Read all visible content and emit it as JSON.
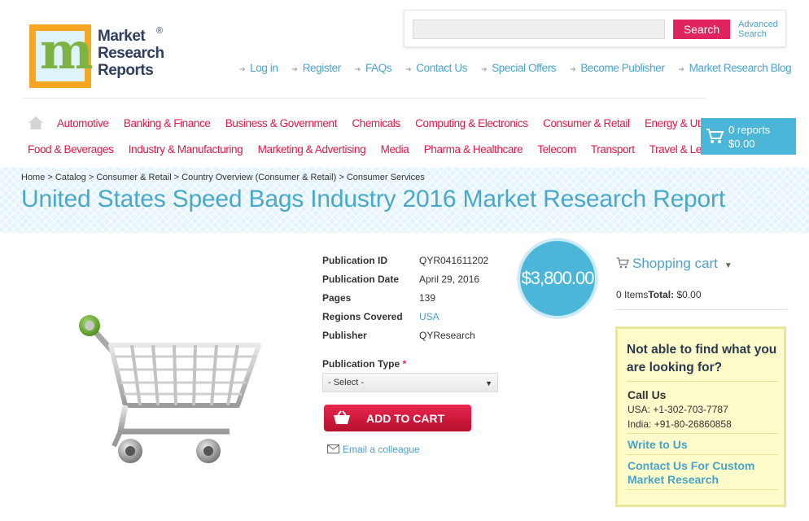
{
  "logo": {
    "line1": "Market",
    "line2": "Research",
    "line3": "Reports",
    "reg": "®",
    "mark": "m"
  },
  "search": {
    "placeholder": "",
    "button": "Search",
    "advanced_line1": "Advanced",
    "advanced_line2": "Search"
  },
  "toplinks": [
    "Log in",
    "Register",
    "FAQs",
    "Contact Us",
    "Special Offers",
    "Become Publisher",
    "Market Research Blog"
  ],
  "categories_row1": [
    "Automotive",
    "Banking & Finance",
    "Business & Government",
    "Chemicals",
    "Computing & Electronics",
    "Consumer & Retail",
    "Energy & Utilities"
  ],
  "categories_row2": [
    "Food & Beverages",
    "Industry & Manufacturing",
    "Marketing & Advertising",
    "Media",
    "Pharma & Healthcare",
    "Telecom",
    "Transport",
    "Travel & Leisure"
  ],
  "cart_box": {
    "reports": "0 reports",
    "total": "$0.00"
  },
  "breadcrumb": "Home > Catalog > Consumer & Retail > Country Overview (Consumer & Retail) > Consumer Services",
  "title": "United States Speed Bags Industry 2016 Market Research Report",
  "details": [
    {
      "label": "Publication ID",
      "value": "QYR041611202"
    },
    {
      "label": "Publication Date",
      "value": "April 29, 2016"
    },
    {
      "label": "Pages",
      "value": "139"
    },
    {
      "label": "Regions Covered",
      "value": "USA"
    },
    {
      "label": "Publisher",
      "value": "QYResearch"
    }
  ],
  "pub_type": {
    "label": "Publication Type",
    "required": "*",
    "selected": "- Select -"
  },
  "add_to_cart": "ADD TO CART",
  "email_colleague": "Email a colleague",
  "price": "$3,800.00",
  "shopping_cart": {
    "title": "Shopping cart",
    "items": "0 Items",
    "total_label": "Total:",
    "total": "$0.00"
  },
  "help": {
    "question": "Not able to find what you are looking for?",
    "call_us": "Call Us",
    "usa": "USA: +1-302-703-7787",
    "india": "India: +91-80-26860858",
    "write": "Write to Us",
    "custom": "Contact Us For Custom Market Research"
  },
  "colors": {
    "accent": "#4bb6d8",
    "brand_red": "#e0245e",
    "logo_orange": "#f6a623"
  }
}
